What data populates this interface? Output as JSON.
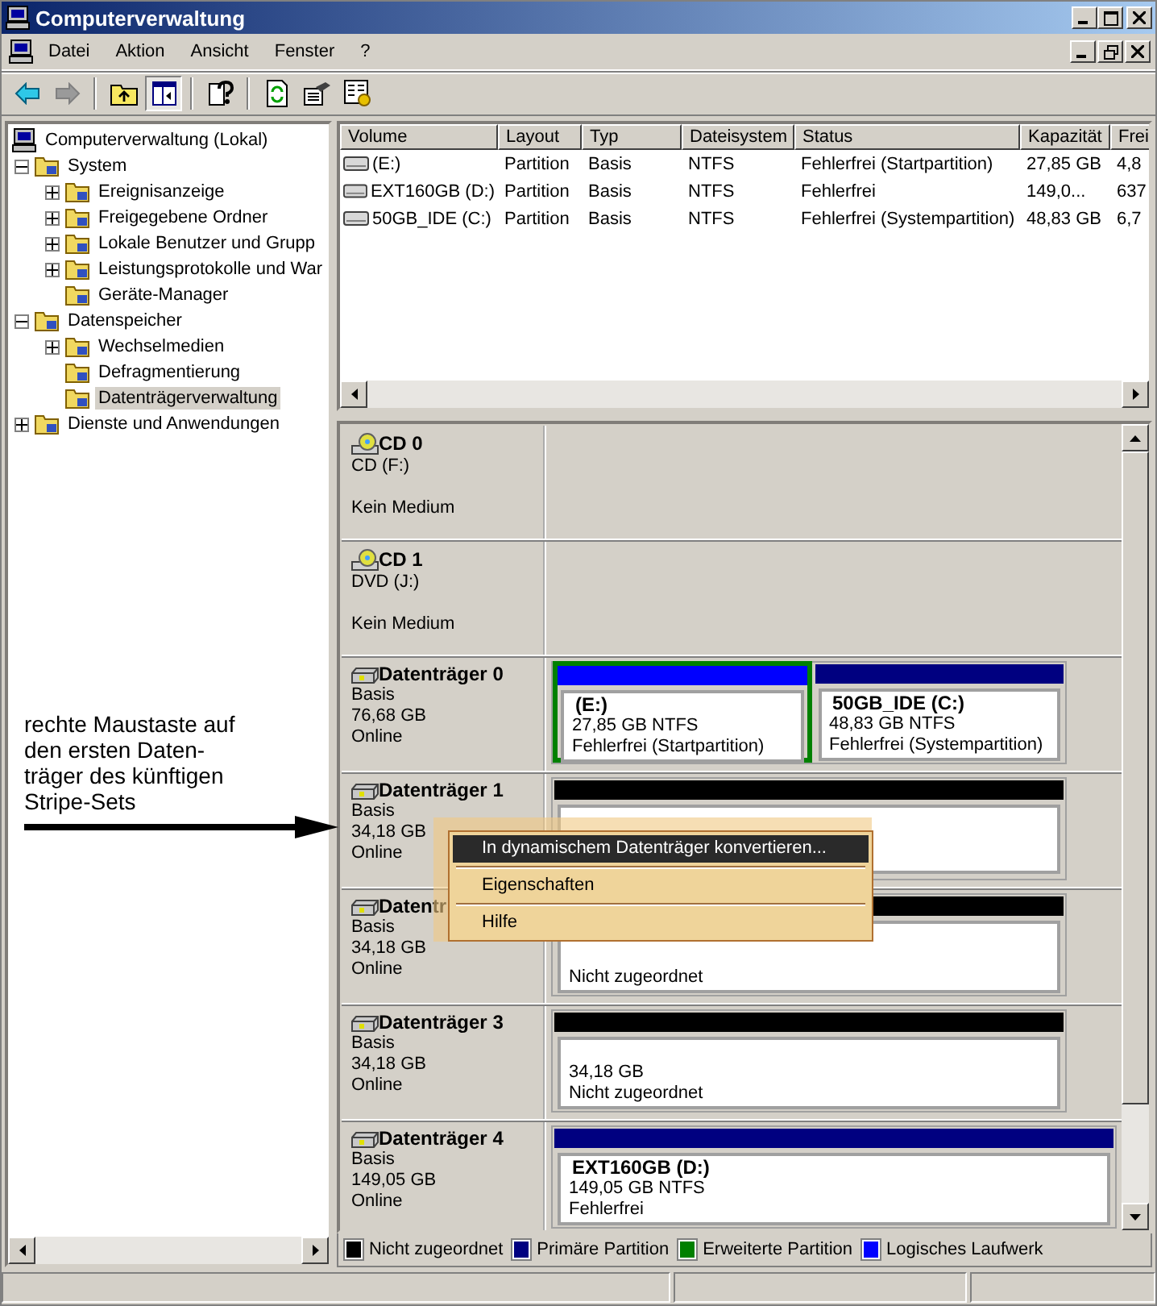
{
  "window": {
    "title": "Computerverwaltung"
  },
  "menu": [
    {
      "label": "Datei"
    },
    {
      "label": "Aktion"
    },
    {
      "label": "Ansicht"
    },
    {
      "label": "Fenster"
    },
    {
      "label": "?"
    }
  ],
  "toolbar": [
    {
      "kind": "back",
      "disabled": false
    },
    {
      "kind": "forward",
      "disabled": true
    },
    {
      "kind": "separator"
    },
    {
      "kind": "up"
    },
    {
      "kind": "tree",
      "pressed": true
    },
    {
      "kind": "separator"
    },
    {
      "kind": "help"
    },
    {
      "kind": "separator"
    },
    {
      "kind": "refresh"
    },
    {
      "kind": "export"
    },
    {
      "kind": "properties"
    }
  ],
  "tree": [
    {
      "label": "Computerverwaltung (Lokal)",
      "selected": false,
      "children": [
        {
          "label": "System",
          "expanded": true,
          "selected": false,
          "children": [
            {
              "label": "Ereignisanzeige",
              "expanded": false,
              "selected": false
            },
            {
              "label": "Freigegebene Ordner",
              "expanded": false,
              "selected": false
            },
            {
              "label": "Lokale Benutzer und Grupp",
              "expanded": false,
              "selected": false
            },
            {
              "label": "Leistungsprotokolle und War",
              "expanded": false,
              "selected": false
            },
            {
              "label": "Geräte-Manager",
              "selected": false
            }
          ]
        },
        {
          "label": "Datenspeicher",
          "expanded": true,
          "selected": false,
          "children": [
            {
              "label": "Wechselmedien",
              "expanded": false,
              "selected": false
            },
            {
              "label": "Defragmentierung",
              "selected": false
            },
            {
              "label": "Datenträgerverwaltung",
              "selected": true
            }
          ]
        },
        {
          "label": "Dienste und Anwendungen",
          "expanded": false,
          "selected": false
        }
      ]
    }
  ],
  "volume_table": {
    "columns": [
      "Volume",
      "Layout",
      "Typ",
      "Dateisystem",
      "Status",
      "Kapazität",
      "Frei"
    ],
    "rows": [
      [
        "(E:)",
        "Partition",
        "Basis",
        "NTFS",
        "Fehlerfrei (Startpartition)",
        "27,85 GB",
        "4,8"
      ],
      [
        "EXT160GB (D:)",
        "Partition",
        "Basis",
        "NTFS",
        "Fehlerfrei",
        "149,0...",
        "637"
      ],
      [
        "50GB_IDE (C:)",
        "Partition",
        "Basis",
        "NTFS",
        "Fehlerfrei (Systempartition)",
        "48,83 GB",
        "6,7"
      ]
    ]
  },
  "disks": [
    {
      "kind": "cd",
      "name": "CD 0",
      "type": "CD (F:)",
      "status": "Kein Medium"
    },
    {
      "kind": "cd",
      "name": "CD 1",
      "type": "DVD (J:)",
      "status": "Kein Medium"
    },
    {
      "kind": "disk",
      "name": "Datenträger 0",
      "type": "Basis",
      "size": "76,68 GB",
      "status": "Online",
      "partitions": [
        {
          "title": "(E:)",
          "size": "27,85 GB NTFS",
          "status": "Fehlerfrei (Startpartition)",
          "color": "#0000ff",
          "selected": true
        },
        {
          "title": "50GB_IDE  (C:)",
          "size": "48,83 GB NTFS",
          "status": "Fehlerfrei (Systempartition)",
          "color": "#000080",
          "selected": false
        }
      ]
    },
    {
      "kind": "disk",
      "name": "Datenträger 1",
      "type": "Basis",
      "size": "34,18 GB",
      "status": "Online",
      "partitions": [
        {
          "color": "#000000",
          "selected": false
        }
      ]
    },
    {
      "kind": "disk",
      "name": "Datentr",
      "type": "Basis",
      "size": "34,18 GB",
      "status": "Online",
      "partitions": [
        {
          "status": "Nicht zugeordnet",
          "color": "#000000",
          "selected": false
        }
      ]
    },
    {
      "kind": "disk",
      "name": "Datenträger 3",
      "type": "Basis",
      "size": "34,18 GB",
      "status": "Online",
      "partitions": [
        {
          "size": "34,18 GB",
          "status": "Nicht zugeordnet",
          "color": "#000000",
          "selected": false
        }
      ]
    },
    {
      "kind": "disk",
      "name": "Datenträger 4",
      "type": "Basis",
      "size": "149,05 GB",
      "status": "Online",
      "partitions": [
        {
          "title": "EXT160GB  (D:)",
          "size": "149,05 GB NTFS",
          "status": "Fehlerfrei",
          "color": "#000080",
          "selected": false
        }
      ]
    }
  ],
  "legend": [
    {
      "label": "Nicht zugeordnet",
      "color": "#000000"
    },
    {
      "label": "Primäre Partition",
      "color": "#000080"
    },
    {
      "label": "Erweiterte Partition",
      "color": "#008000"
    },
    {
      "label": "Logisches Laufwerk",
      "color": "#0000ff"
    }
  ],
  "context_menu": {
    "items": [
      {
        "label": "In dynamischem Datenträger konvertieren...",
        "selected": true
      },
      {
        "label": "Eigenschaften",
        "selected": false
      },
      {
        "label": "Hilfe",
        "selected": false
      }
    ]
  },
  "annotation": {
    "text": "rechte Maustaste auf\nden ersten Daten-\nträger des künftigen\nStripe-Sets"
  }
}
